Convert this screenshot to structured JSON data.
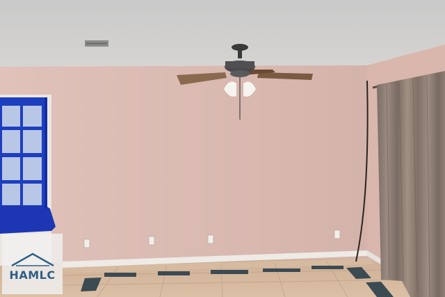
{
  "watermark": {
    "text": "HAMLC"
  },
  "colors": {
    "ceiling": "#cfcfcf",
    "wall": "#dcbcb4",
    "window_frame": "#1a3fb8",
    "curtain": "#8a7a70",
    "floor": "#d2b49a",
    "floor_accent": "#3c4a52",
    "watermark_text": "#2f5f86"
  },
  "icons": [
    "ceiling-fan-icon",
    "window-icon",
    "curtain-icon",
    "outlet-icon",
    "house-logo-icon"
  ]
}
